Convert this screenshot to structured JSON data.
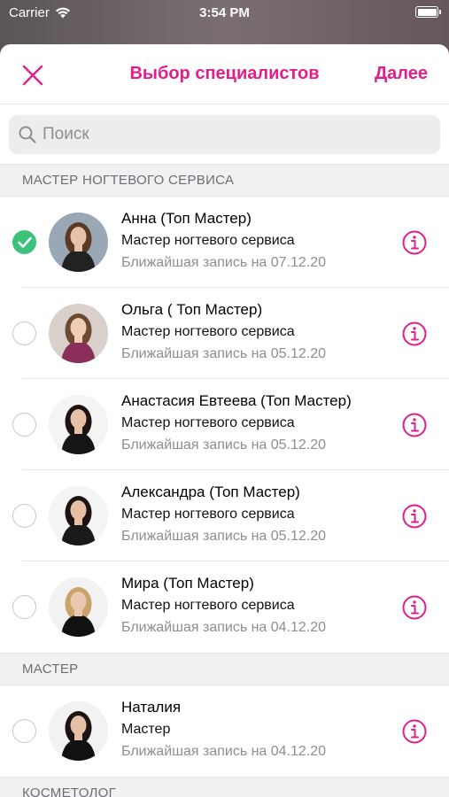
{
  "status_bar": {
    "carrier": "Carrier",
    "time": "3:54 PM"
  },
  "nav": {
    "title": "Выбор специалистов",
    "next_label": "Далее",
    "close_icon": "close-icon"
  },
  "search": {
    "placeholder": "Поиск",
    "value": ""
  },
  "colors": {
    "accent": "#e01e8c",
    "check": "#3cc27a"
  },
  "sections": [
    {
      "title": "МАСТЕР НОГТЕВОГО СЕРВИСА",
      "items": [
        {
          "name": "Анна (Топ Мастер)",
          "role": "Мастер ногтевого сервиса",
          "next": "Ближайшая запись на 07.12.20",
          "selected": true
        },
        {
          "name": "Ольга ( Топ Мастер)",
          "role": "Мастер ногтевого сервиса",
          "next": "Ближайшая запись на 05.12.20",
          "selected": false
        },
        {
          "name": "Анастасия Евтеева (Топ Мастер)",
          "role": "Мастер ногтевого сервиса",
          "next": "Ближайшая запись на 05.12.20",
          "selected": false
        },
        {
          "name": "Александра (Топ Мастер)",
          "role": "Мастер ногтевого сервиса",
          "next": "Ближайшая запись на 05.12.20",
          "selected": false
        },
        {
          "name": "Мира (Топ Мастер)",
          "role": "Мастер ногтевого сервиса",
          "next": "Ближайшая запись на 04.12.20",
          "selected": false
        }
      ]
    },
    {
      "title": "МАСТЕР",
      "items": [
        {
          "name": "Наталия",
          "role": "Мастер",
          "next": "Ближайшая запись на 04.12.20",
          "selected": false
        }
      ]
    },
    {
      "title": "КОСМЕТОЛОГ",
      "items": []
    }
  ]
}
